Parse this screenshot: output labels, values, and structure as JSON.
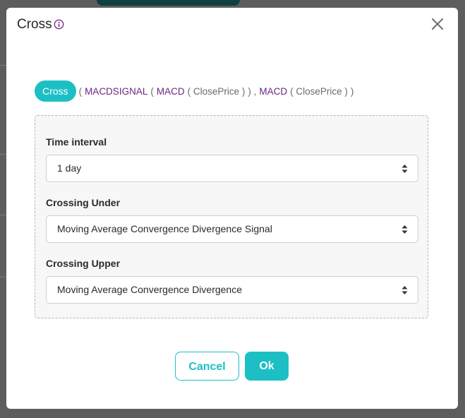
{
  "dialog": {
    "title": "Cross",
    "expression": {
      "pill": "Cross",
      "tokens": [
        {
          "text": "(",
          "kind": "arg"
        },
        {
          "text": "MACDSIGNAL",
          "kind": "fn"
        },
        {
          "text": "(",
          "kind": "arg"
        },
        {
          "text": "MACD",
          "kind": "fn"
        },
        {
          "text": "( ClosePrice )",
          "kind": "arg"
        },
        {
          "text": ") ,",
          "kind": "arg"
        },
        {
          "text": "MACD",
          "kind": "fn"
        },
        {
          "text": "( ClosePrice )",
          "kind": "arg"
        },
        {
          "text": ")",
          "kind": "arg"
        }
      ]
    },
    "fields": {
      "time_interval": {
        "label": "Time interval",
        "value": "1 day"
      },
      "crossing_under": {
        "label": "Crossing Under",
        "value": "Moving Average Convergence Divergence Signal"
      },
      "crossing_upper": {
        "label": "Crossing Upper",
        "value": "Moving Average Convergence Divergence"
      }
    },
    "buttons": {
      "cancel": "Cancel",
      "ok": "Ok"
    }
  },
  "colors": {
    "accent": "#1cc0c4",
    "function_text": "#6a2680",
    "argument_text": "#6b6b6b",
    "info_icon": "#7b2f94",
    "overlay": "#5d5d5d"
  },
  "icons": {
    "info": "info-icon",
    "close": "close-icon",
    "select": "sort-arrows-icon"
  }
}
